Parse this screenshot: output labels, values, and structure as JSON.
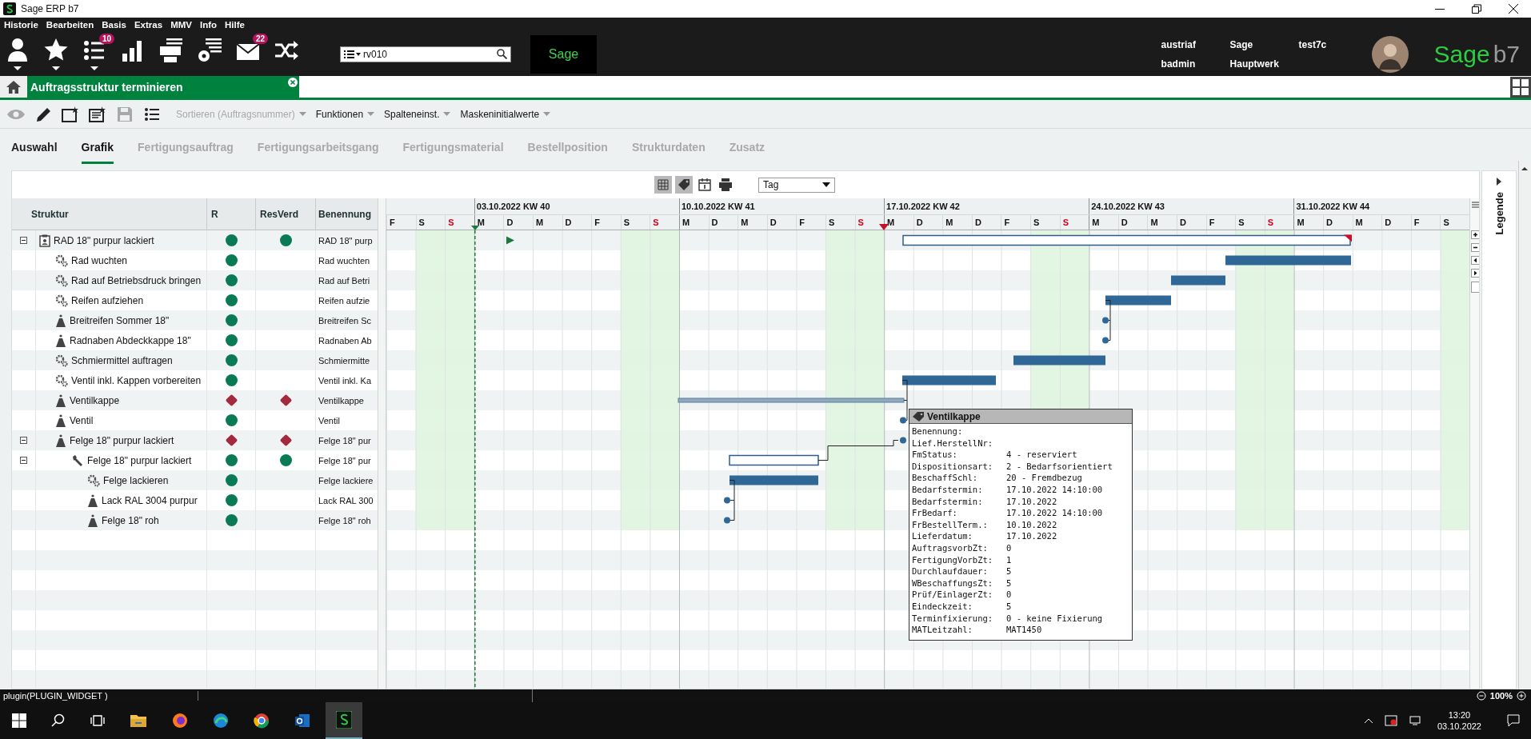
{
  "window": {
    "title": "Sage ERP b7"
  },
  "menu": [
    "Historie",
    "Bearbeiten",
    "Basis",
    "Extras",
    "MMV",
    "Info",
    "Hilfe"
  ],
  "main_toolbar": {
    "list_badge": "10",
    "mail_badge": "22"
  },
  "search": {
    "value": "rv010"
  },
  "brand_box": "Sage",
  "user_info": [
    [
      "austriaf",
      "Sage",
      "test7c"
    ],
    [
      "badmin",
      "Hauptwerk"
    ]
  ],
  "logo": {
    "name": "Sage",
    "version": "b7"
  },
  "open_tab": {
    "title": "Auftragsstruktur terminieren"
  },
  "action_icons": [
    {
      "kind": "view",
      "disabled": true
    },
    {
      "kind": "edit",
      "disabled": false
    },
    {
      "kind": "new",
      "disabled": false
    },
    {
      "kind": "new-copy",
      "disabled": false
    },
    {
      "kind": "save",
      "disabled": true
    },
    {
      "kind": "list",
      "disabled": false
    }
  ],
  "actions": [
    {
      "label": "Sortieren (Auftragsnummer)",
      "disabled": true
    },
    {
      "label": "Funktionen",
      "disabled": false
    },
    {
      "label": "Spalteneinst.",
      "disabled": false
    },
    {
      "label": "Maskeninitialwerte",
      "disabled": false
    }
  ],
  "tabs": [
    {
      "label": "Auswahl",
      "selected": false,
      "disabled": false
    },
    {
      "label": "Grafik",
      "selected": true,
      "disabled": false
    },
    {
      "label": "Fertigungsauftrag",
      "selected": false,
      "disabled": true
    },
    {
      "label": "Fertigungsarbeitsgang",
      "selected": false,
      "disabled": true
    },
    {
      "label": "Fertigungsmaterial",
      "selected": false,
      "disabled": true
    },
    {
      "label": "Bestellposition",
      "selected": false,
      "disabled": true
    },
    {
      "label": "Strukturdaten",
      "selected": false,
      "disabled": true
    },
    {
      "label": "Zusatz",
      "selected": false,
      "disabled": true
    }
  ],
  "view_select": {
    "value": "Tag"
  },
  "table": {
    "columns": [
      "Struktur",
      "R",
      "ResVerd",
      "Benennung"
    ],
    "rows": [
      {
        "kind": "assembly",
        "name": "RAD 18\" purpur lackiert",
        "r_ok": true,
        "resverd_ok": true,
        "benennung": "RAD 18\" purp",
        "expanded": true,
        "children": [
          {
            "kind": "operation",
            "name": "Rad wuchten",
            "r_ok": true,
            "benennung": "Rad wuchten"
          },
          {
            "kind": "operation",
            "name": "Rad auf Betriebsdruck bringen",
            "r_ok": true,
            "benennung": "Rad auf Betri"
          },
          {
            "kind": "operation",
            "name": "Reifen aufziehen",
            "r_ok": true,
            "benennung": "Reifen aufzie"
          },
          {
            "kind": "material",
            "name": "Breitreifen Sommer 18\"",
            "r_ok": true,
            "benennung": "Breitreifen Sc"
          },
          {
            "kind": "material",
            "name": "Radnaben Abdeckkappe 18\"",
            "r_ok": true,
            "benennung": "Radnaben Ab"
          },
          {
            "kind": "operation",
            "name": "Schmiermittel auftragen",
            "r_ok": true,
            "benennung": "Schmiermitte"
          },
          {
            "kind": "operation",
            "name": "Ventil inkl. Kappen vorbereiten",
            "r_ok": true,
            "benennung": "Ventil inkl. Ka"
          },
          {
            "kind": "material",
            "name": "Ventilkappe",
            "r_ok": false,
            "resverd_ok": false,
            "benennung": "Ventilkappe"
          },
          {
            "kind": "material",
            "name": "Ventil",
            "r_ok": true,
            "benennung": "Ventil"
          },
          {
            "kind": "material",
            "name": "Felge 18\" purpur lackiert",
            "r_ok": false,
            "resverd_ok": false,
            "benennung": "Felge 18\" pur",
            "expanded": true,
            "children": [
              {
                "kind": "order",
                "name": "Felge 18\" purpur lackiert",
                "r_ok": true,
                "resverd_ok": true,
                "benennung": "Felge 18\" pur",
                "expanded": true,
                "children": [
                  {
                    "kind": "operation",
                    "name": "Felge lackieren",
                    "r_ok": true,
                    "benennung": "Felge lackiere"
                  },
                  {
                    "kind": "material",
                    "name": "Lack RAL 3004 purpur",
                    "r_ok": true,
                    "benennung": "Lack RAL 300"
                  },
                  {
                    "kind": "material",
                    "name": "Felge 18\" roh",
                    "r_ok": true,
                    "benennung": "Felge 18\" roh"
                  }
                ]
              }
            ]
          }
        ]
      }
    ]
  },
  "gantt": {
    "days": [
      {
        "letter": "F",
        "kind": "weekday"
      },
      {
        "letter": "S",
        "kind": "saturday"
      },
      {
        "letter": "S",
        "kind": "sunday"
      },
      {
        "letter": "M",
        "kind": "weekday",
        "week": "03.10.2022 KW 40",
        "today": true
      },
      {
        "letter": "D",
        "kind": "weekday"
      },
      {
        "letter": "M",
        "kind": "weekday"
      },
      {
        "letter": "D",
        "kind": "weekday"
      },
      {
        "letter": "F",
        "kind": "weekday"
      },
      {
        "letter": "S",
        "kind": "saturday"
      },
      {
        "letter": "S",
        "kind": "sunday"
      },
      {
        "letter": "M",
        "kind": "weekday",
        "week": "10.10.2022 KW 41"
      },
      {
        "letter": "D",
        "kind": "weekday"
      },
      {
        "letter": "M",
        "kind": "weekday"
      },
      {
        "letter": "D",
        "kind": "weekday"
      },
      {
        "letter": "F",
        "kind": "weekday"
      },
      {
        "letter": "S",
        "kind": "saturday"
      },
      {
        "letter": "S",
        "kind": "sunday"
      },
      {
        "letter": "M",
        "kind": "weekday",
        "week": "17.10.2022 KW 42",
        "marker": true
      },
      {
        "letter": "D",
        "kind": "weekday"
      },
      {
        "letter": "M",
        "kind": "weekday"
      },
      {
        "letter": "D",
        "kind": "weekday"
      },
      {
        "letter": "F",
        "kind": "weekday"
      },
      {
        "letter": "S",
        "kind": "saturday"
      },
      {
        "letter": "S",
        "kind": "sunday"
      },
      {
        "letter": "M",
        "kind": "weekday",
        "week": "24.10.2022 KW 43"
      },
      {
        "letter": "D",
        "kind": "weekday"
      },
      {
        "letter": "M",
        "kind": "weekday"
      },
      {
        "letter": "D",
        "kind": "weekday"
      },
      {
        "letter": "F",
        "kind": "weekday"
      },
      {
        "letter": "S",
        "kind": "saturday"
      },
      {
        "letter": "S",
        "kind": "sunday"
      },
      {
        "letter": "M",
        "kind": "weekday",
        "week": "31.10.2022 KW 44"
      },
      {
        "letter": "D",
        "kind": "weekday"
      },
      {
        "letter": "M",
        "kind": "weekday"
      },
      {
        "letter": "D",
        "kind": "weekday"
      },
      {
        "letter": "F",
        "kind": "weekday"
      },
      {
        "letter": "S",
        "kind": "saturday"
      }
    ]
  },
  "tooltip": {
    "title": "Ventilkappe",
    "fields": [
      {
        "label": "Benennung:"
      },
      {
        "label": "Lief.HerstellNr:"
      },
      {
        "label": "FmStatus:",
        "value": "4 - reserviert"
      },
      {
        "label": "Dispositionsart:",
        "value": "2 - Bedarfsorientiert"
      },
      {
        "label": "BeschaffSchl:",
        "value": "20 - Fremdbezug"
      },
      {
        "label": "Bedarfstermin:",
        "value": "17.10.2022 14:10:00"
      },
      {
        "label": "Bedarfstermin:",
        "value": "17.10.2022"
      },
      {
        "label": "FrBedarf:",
        "value": "17.10.2022 14:10:00"
      },
      {
        "label": "FrBestellTerm.:",
        "value": "10.10.2022"
      },
      {
        "label": "Lieferdatum:",
        "value": "17.10.2022"
      },
      {
        "label": "AuftragsvorbZt:",
        "value": "0"
      },
      {
        "label": "FertigungVorbZt:",
        "value": "1"
      },
      {
        "label": "Durchlaufdauer:",
        "value": "5"
      },
      {
        "label": "WBeschaffungsZt:",
        "value": "5"
      },
      {
        "label": "Prüf/EinlagerZt:",
        "value": "0"
      },
      {
        "label": "Eindeckzeit:",
        "value": "5"
      },
      {
        "label": "Terminfixierung:",
        "value": "0 - keine Fixierung"
      },
      {
        "label": "MATLeitzahl:",
        "value": "MAT1450"
      }
    ]
  },
  "legend": {
    "label": "Legende"
  },
  "status_bar": {
    "text": "plugin(PLUGIN_WIDGET )",
    "zoom": "100%"
  },
  "taskbar": {
    "time": "13:20",
    "date": "03.10.2022"
  }
}
